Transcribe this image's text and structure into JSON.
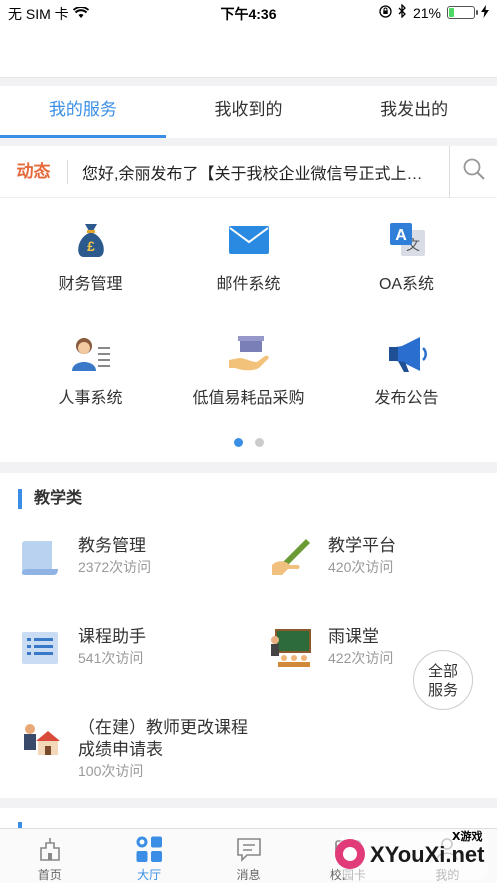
{
  "status": {
    "carrier": "无 SIM 卡",
    "time": "下午4:36",
    "battery": "21%",
    "battery_level": 0.21
  },
  "tabs": [
    {
      "label": "我的服务",
      "active": true
    },
    {
      "label": "我收到的",
      "active": false
    },
    {
      "label": "我发出的",
      "active": false
    }
  ],
  "ticker": {
    "tag": "动态",
    "text": "您好,余丽发布了【关于我校企业微信号正式上线的通知】"
  },
  "services": [
    {
      "label": "财务管理",
      "icon": "money-bag-icon"
    },
    {
      "label": "邮件系统",
      "icon": "mail-icon"
    },
    {
      "label": "OA系统",
      "icon": "translate-icon"
    },
    {
      "label": "人事系统",
      "icon": "person-card-icon"
    },
    {
      "label": "低值易耗品采购",
      "icon": "hand-box-icon"
    },
    {
      "label": "发布公告",
      "icon": "megaphone-icon"
    }
  ],
  "section": {
    "title": "教学类",
    "items": [
      {
        "name": "教务管理",
        "visits": "2372次访问"
      },
      {
        "name": "教学平台",
        "visits": "420次访问"
      },
      {
        "name": "课程助手",
        "visits": "541次访问"
      },
      {
        "name": "雨课堂",
        "visits": "422次访问"
      },
      {
        "name": "（在建）教师更改课程成绩申请表",
        "visits": "100次访问"
      }
    ]
  },
  "fab": {
    "line1": "全部",
    "line2": "服务"
  },
  "bottom_nav": [
    {
      "label": "首页",
      "active": false
    },
    {
      "label": "大厅",
      "active": true
    },
    {
      "label": "消息",
      "active": false
    },
    {
      "label": "校园卡",
      "active": false
    },
    {
      "label": "我的",
      "active": false
    }
  ],
  "watermark": {
    "brand": "XYouXi.net",
    "tag": "X游戏"
  },
  "colors": {
    "accent": "#3a8ee6",
    "tag": "#e66b3c"
  }
}
